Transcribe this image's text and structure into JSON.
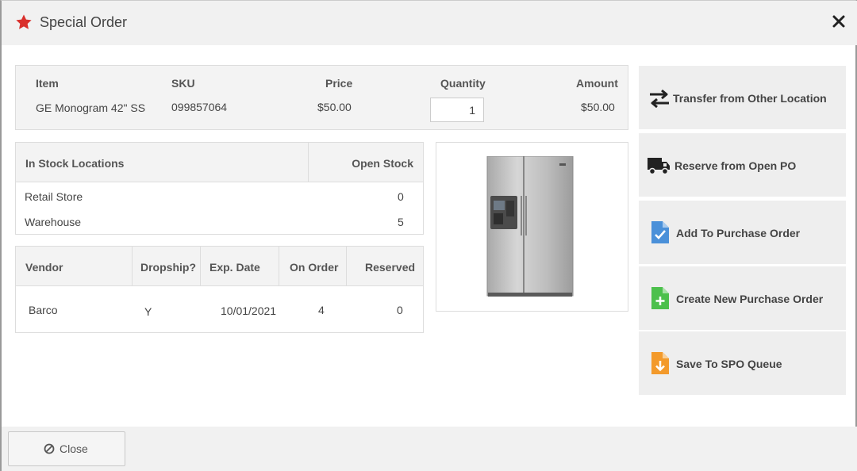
{
  "dialog": {
    "title": "Special Order",
    "close_label": "Close"
  },
  "item": {
    "headers": {
      "item": "Item",
      "sku": "SKU",
      "price": "Price",
      "quantity": "Quantity",
      "amount": "Amount"
    },
    "name": "GE Monogram 42\" SS",
    "sku": "099857064",
    "price": "$50.00",
    "quantity": "1",
    "amount": "$50.00"
  },
  "stock": {
    "headers": {
      "location": "In Stock Locations",
      "open_stock": "Open Stock"
    },
    "rows": [
      {
        "location": "Retail Store",
        "open_stock": "0"
      },
      {
        "location": "Warehouse",
        "open_stock": "5"
      }
    ]
  },
  "vendors": {
    "headers": {
      "vendor": "Vendor",
      "dropship": "Dropship?",
      "exp_date": "Exp. Date",
      "on_order": "On Order",
      "reserved": "Reserved"
    },
    "rows": [
      {
        "vendor": "Barco",
        "dropship": "Y",
        "exp_date": "10/01/2021",
        "on_order": "4",
        "reserved": "0"
      }
    ]
  },
  "actions": {
    "transfer": "Transfer from Other Location",
    "reserve": "Reserve from Open PO",
    "add_po": "Add To Purchase Order",
    "create_po": "Create New Purchase Order",
    "save_spo": "Save To SPO Queue"
  },
  "icons": {
    "title": "star-icon",
    "close": "close-icon",
    "transfer": "transfer-arrows-icon",
    "reserve": "truck-icon",
    "add_po": "document-check-icon",
    "create_po": "document-plus-icon",
    "save_spo": "document-download-icon",
    "close_button": "ban-icon",
    "product": "refrigerator-image"
  },
  "colors": {
    "star": "#d9302c",
    "doc_blue": "#4a90d9",
    "doc_green": "#4cc04c",
    "doc_orange": "#f39a2b"
  }
}
